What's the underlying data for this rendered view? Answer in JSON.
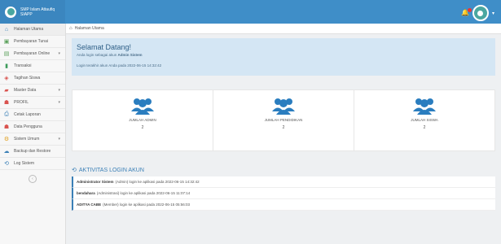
{
  "header": {
    "brand_title": "SMP Islam Attaufiq",
    "brand_subtitle": "SIAPP"
  },
  "sidebar": {
    "items": [
      {
        "label": "Halaman Utama",
        "icon": "home-icon",
        "chev": ""
      },
      {
        "label": "Pembayaran Tunai",
        "icon": "money-icon",
        "chev": ""
      },
      {
        "label": "Pembayaran Online",
        "icon": "card-icon",
        "chev": "▾"
      },
      {
        "label": "Transaksi",
        "icon": "book-icon",
        "chev": ""
      },
      {
        "label": "Tagihan Siswa",
        "icon": "tag-icon",
        "chev": ""
      },
      {
        "label": "Master Data",
        "icon": "folder-icon",
        "chev": "▾"
      },
      {
        "label": "PROFIL",
        "icon": "users-icon",
        "chev": "▾"
      },
      {
        "label": "Cetak Laporan",
        "icon": "print-icon",
        "chev": ""
      },
      {
        "label": "Data Pengguna",
        "icon": "users-icon",
        "chev": ""
      },
      {
        "label": "Sistem Umum",
        "icon": "gear-icon",
        "chev": "▾"
      },
      {
        "label": "Backup dan Restore",
        "icon": "cloud-icon",
        "chev": ""
      },
      {
        "label": "Log Sistem",
        "icon": "history-icon",
        "chev": ""
      }
    ],
    "collapse": "‹"
  },
  "breadcrumb": {
    "label": "Halaman Utama"
  },
  "welcome": {
    "title": "Selamat Datang!",
    "login_prefix": "Anda login sebagai akun ",
    "login_account": "Admin Sistem",
    "last_login": "Login terakhir akun Anda pada 2022-06-15 14:32:42"
  },
  "stats": [
    {
      "label": "JUMLAH ADMIN",
      "value": "2"
    },
    {
      "label": "JUMLAH PENDIDIKAN",
      "value": "2"
    },
    {
      "label": "JUMLAH SISWA",
      "value": "2"
    }
  ],
  "activity": {
    "title": "AKTIVITAS LOGIN AKUN",
    "rows": [
      {
        "name": "Administrator Sistem",
        "text": "(Admin) login ke aplikasi pada 2022-06-15 14:32:42"
      },
      {
        "name": "bendahara",
        "text": "(Administrasi) login ke aplikasi pada 2022-06-15 11:07:14"
      },
      {
        "name": "ADITYA CABE",
        "text": "(Member) login ke aplikasi pada 2022-06-15 05:56:03"
      }
    ]
  },
  "colors": {
    "topbar": "#3f8ec8",
    "accent": "#3a7fb6",
    "welcome_bg": "#d4e6f4",
    "stat_icon": "#2a7dbf"
  }
}
